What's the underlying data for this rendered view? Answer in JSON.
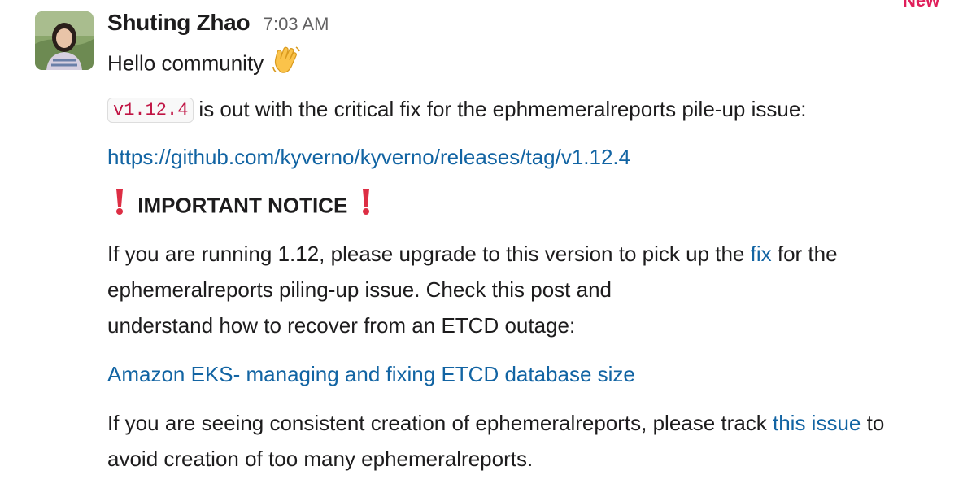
{
  "new_label": "New",
  "message": {
    "author": "Shuting Zhao",
    "time": "7:03 AM",
    "greeting": "Hello community",
    "version_code": "v1.12.4",
    "release_text": "is out with the critical fix for the ephmemeralreports pile-up issue:",
    "release_link": "https://github.com/kyverno/kyverno/releases/tag/v1.12.4",
    "notice": "IMPORTANT NOTICE",
    "upgrade_text_1": "If you are running 1.12, please upgrade to this version to pick up the ",
    "upgrade_link": "fix",
    "upgrade_text_2": " for the ephemeralreports piling-up issue. Check this post and",
    "upgrade_text_3": "understand how to recover from an ETCD outage:",
    "eks_link": "Amazon EKS- managing and fixing ETCD database size",
    "track_text_1": "If you are seeing consistent creation of ephemeralreports, please track ",
    "track_link": "this issue",
    "track_text_2": " to avoid creation of too many ephemeralreports."
  },
  "icons": {
    "avatar": "user-avatar",
    "wave": "waving-hand-icon",
    "exclamation": "red-exclamation-icon"
  },
  "colors": {
    "link": "#1264a3",
    "code_text": "#c01343",
    "new_badge": "#e01e5a",
    "exclamation": "#dd2e44",
    "timestamp": "#616061"
  }
}
